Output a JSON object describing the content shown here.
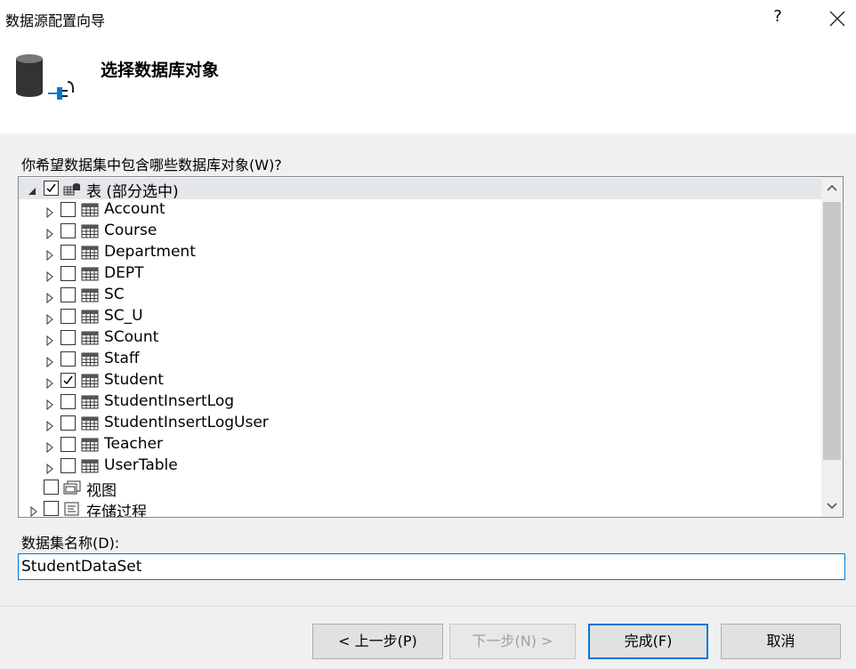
{
  "window": {
    "title": "数据源配置向导",
    "help_label": "?"
  },
  "header": {
    "heading": "选择数据库对象"
  },
  "tree": {
    "prompt": "你希望数据集中包含哪些数据库对象(W)?",
    "tables_node": {
      "label": "表 (部分选中)",
      "checked": true,
      "expanded": true
    },
    "tables": [
      {
        "label": "Account",
        "checked": false
      },
      {
        "label": "Course",
        "checked": false
      },
      {
        "label": "Department",
        "checked": false
      },
      {
        "label": "DEPT",
        "checked": false
      },
      {
        "label": "SC",
        "checked": false
      },
      {
        "label": "SC_U",
        "checked": false
      },
      {
        "label": "SCount",
        "checked": false
      },
      {
        "label": "Staff",
        "checked": false
      },
      {
        "label": "Student",
        "checked": true
      },
      {
        "label": "StudentInsertLog",
        "checked": false
      },
      {
        "label": "StudentInsertLogUser",
        "checked": false
      },
      {
        "label": "Teacher",
        "checked": false
      },
      {
        "label": "UserTable",
        "checked": false
      }
    ],
    "views_node": {
      "label": "视图",
      "checked": false
    },
    "procs_node": {
      "label": "存储过程",
      "checked": false
    }
  },
  "dataset": {
    "label": "数据集名称(D):",
    "value": "StudentDataSet"
  },
  "buttons": {
    "back": "< 上一步(P)",
    "next": "下一步(N) >",
    "finish": "完成(F)",
    "cancel": "取消"
  }
}
